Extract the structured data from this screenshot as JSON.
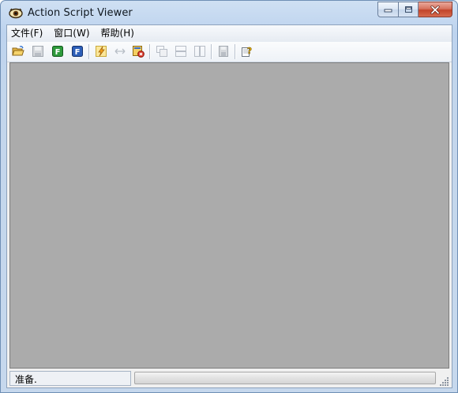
{
  "window": {
    "title": "Action Script Viewer",
    "app_icon": "eye-icon",
    "buttons": {
      "minimize": "minimize-icon",
      "maximize": "maximize-icon",
      "close": "close-icon"
    }
  },
  "menubar": {
    "items": [
      {
        "label": "文件(F)"
      },
      {
        "label": "窗口(W)"
      },
      {
        "label": "帮助(H)"
      }
    ]
  },
  "toolbar": {
    "buttons": [
      {
        "icon": "open-folder-icon",
        "enabled": true
      },
      {
        "icon": "save-icon",
        "enabled": false
      },
      {
        "icon": "green-f-icon",
        "enabled": true
      },
      {
        "icon": "blue-f-icon",
        "enabled": true
      },
      {
        "icon": "lightning-icon",
        "enabled": true
      },
      {
        "icon": "resize-arrows-icon",
        "enabled": false
      },
      {
        "icon": "close-file-icon",
        "enabled": true
      },
      {
        "icon": "cascade-icon",
        "enabled": false
      },
      {
        "icon": "tile-horizontal-icon",
        "enabled": false
      },
      {
        "icon": "tile-vertical-icon",
        "enabled": false
      },
      {
        "icon": "save-as-icon",
        "enabled": false
      },
      {
        "icon": "help-icon",
        "enabled": true
      }
    ]
  },
  "colors": {
    "workspace": "#ababab",
    "window_frame": "#bdd3ee",
    "close_button": "#c2442a"
  },
  "statusbar": {
    "text": "准备."
  }
}
